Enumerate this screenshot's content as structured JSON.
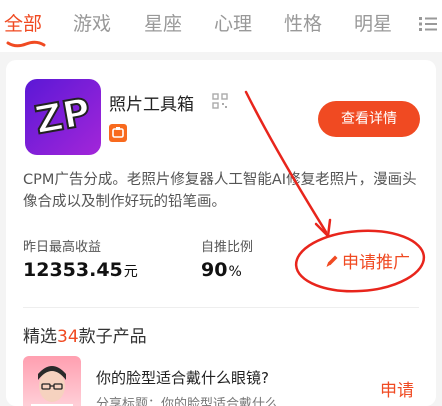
{
  "tabs": [
    {
      "label": "全部",
      "active": true
    },
    {
      "label": "游戏",
      "active": false
    },
    {
      "label": "星座",
      "active": false
    },
    {
      "label": "心理",
      "active": false
    },
    {
      "label": "性格",
      "active": false
    },
    {
      "label": "明星",
      "active": false
    }
  ],
  "app": {
    "icon_text": "ZP",
    "name": "照片工具箱",
    "detail_button": "查看详情",
    "description": "CPM广告分成。老照片修复器人工智能AI修复老照片，漫画头像合成以及制作好玩的铅笔画。",
    "stats": {
      "yesterday_label": "昨日最高收益",
      "yesterday_value": "12353.45",
      "yesterday_unit": "元",
      "ratio_label": "自推比例",
      "ratio_value": "90",
      "ratio_unit": "%"
    },
    "apply_promo": "申请推广"
  },
  "products": {
    "title_prefix": "精选",
    "count": "34",
    "title_suffix": "款子产品",
    "items": [
      {
        "title": "你的脸型适合戴什么眼镜?",
        "subtitle": "分享标题：你的脸型适合戴什么",
        "action": "申请"
      }
    ]
  },
  "colors": {
    "accent": "#f04a22",
    "annotation": "#e8251c",
    "app_icon_gradient": [
      "#5b18d6",
      "#a326d9"
    ]
  },
  "icons": [
    "menu-icon",
    "qr-code-icon",
    "pencil-icon",
    "app-logo-icon"
  ]
}
